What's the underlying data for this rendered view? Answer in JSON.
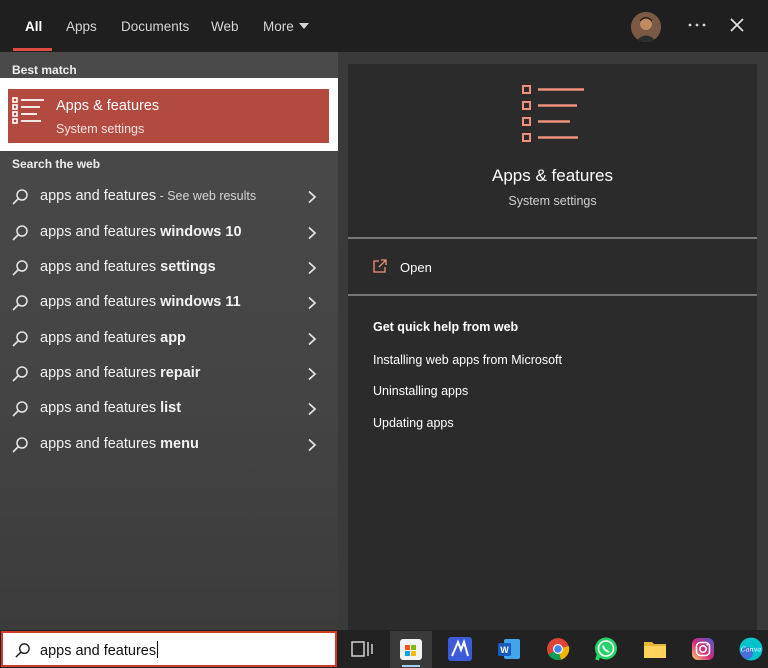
{
  "tabs": [
    {
      "label": "All",
      "active": true
    },
    {
      "label": "Apps"
    },
    {
      "label": "Documents"
    },
    {
      "label": "Web"
    },
    {
      "label": "More"
    }
  ],
  "left": {
    "best_match_label": "Best match",
    "best_match": {
      "title": "Apps & features",
      "subtitle": "System settings",
      "icon": "apps-features-icon"
    },
    "search_web_label": "Search the web",
    "results": [
      {
        "prefix": "apps and features",
        "bold": "",
        "suffix": " - See web results"
      },
      {
        "prefix": "apps and features ",
        "bold": "windows 10",
        "suffix": ""
      },
      {
        "prefix": "apps and features ",
        "bold": "settings",
        "suffix": ""
      },
      {
        "prefix": "apps and features ",
        "bold": "windows 11",
        "suffix": ""
      },
      {
        "prefix": "apps and features ",
        "bold": "app",
        "suffix": ""
      },
      {
        "prefix": "apps and features ",
        "bold": "repair",
        "suffix": ""
      },
      {
        "prefix": "apps and features ",
        "bold": "list",
        "suffix": ""
      },
      {
        "prefix": "apps and features ",
        "bold": "menu",
        "suffix": ""
      }
    ]
  },
  "right": {
    "title": "Apps & features",
    "subtitle": "System settings",
    "open_label": "Open",
    "help_heading": "Get quick help from web",
    "help_links": [
      "Installing web apps from Microsoft",
      "Uninstalling apps",
      "Updating apps"
    ]
  },
  "search": {
    "value": "apps and features"
  },
  "taskbar": {
    "icons": [
      "task-view-icon",
      "microsoft-store-icon",
      "microsoft-app-icon",
      "word-icon",
      "chrome-icon",
      "whatsapp-icon",
      "file-explorer-icon",
      "instagram-icon",
      "canva-icon"
    ]
  },
  "colors": {
    "accent": "#b34a3f",
    "tab_underline": "#e04b3f",
    "search_border": "#d23a2e",
    "icon_salmon": "#f0907a"
  }
}
